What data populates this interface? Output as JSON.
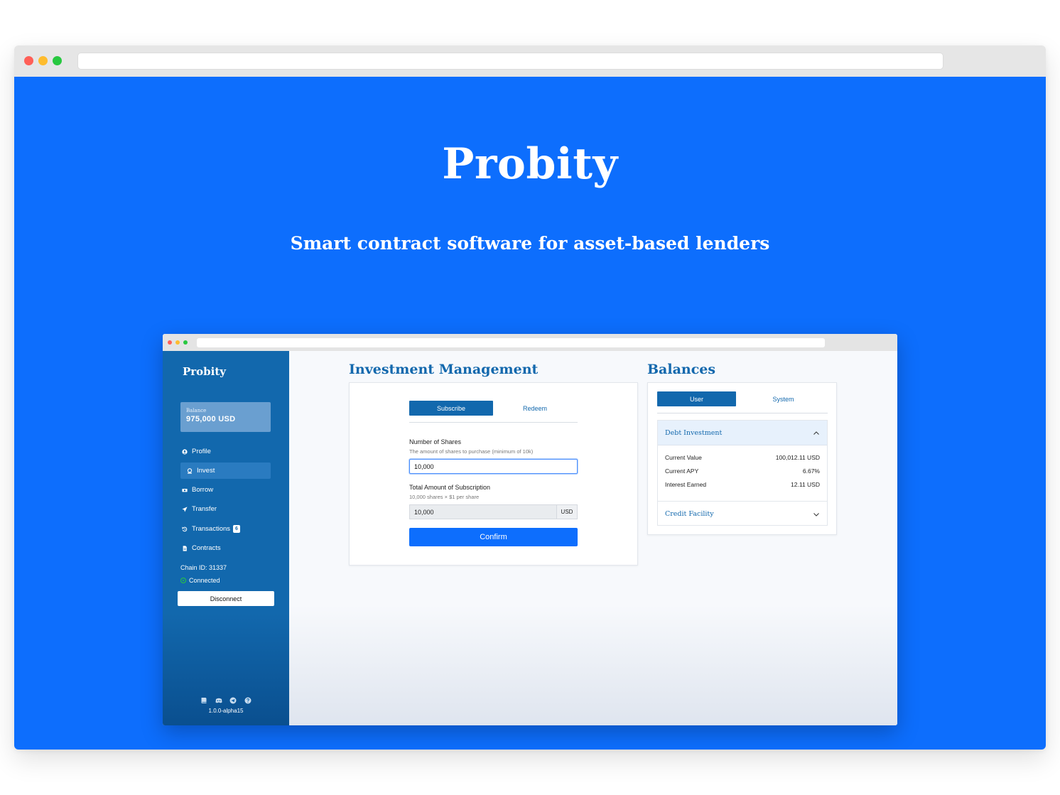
{
  "hero": {
    "title": "Probity",
    "subtitle": "Smart contract software for asset-based lenders"
  },
  "app": {
    "logo": "Probity",
    "balance": {
      "label": "Balance",
      "value": "975,000 USD"
    },
    "nav": [
      {
        "label": "Profile",
        "icon": "profile-icon",
        "active": false
      },
      {
        "label": "Invest",
        "icon": "invest-icon",
        "active": true
      },
      {
        "label": "Borrow",
        "icon": "borrow-icon",
        "active": false
      },
      {
        "label": "Transfer",
        "icon": "transfer-icon",
        "active": false
      },
      {
        "label": "Transactions",
        "icon": "transactions-icon",
        "active": false,
        "badge": "6"
      },
      {
        "label": "Contracts",
        "icon": "contracts-icon",
        "active": false
      }
    ],
    "chain_id": "Chain ID: 31337",
    "status": "Connected",
    "disconnect_label": "Disconnect",
    "footer_icons": [
      "docs-icon",
      "discord-icon",
      "telegram-icon",
      "help-icon"
    ],
    "version": "1.0.0-alpha15"
  },
  "investment": {
    "title": "Investment Management",
    "tabs": {
      "subscribe": "Subscribe",
      "redeem": "Redeem"
    },
    "shares": {
      "label": "Number of Shares",
      "hint": "The amount of shares to purchase (minimum of 10k)",
      "value": "10,000"
    },
    "total": {
      "label": "Total Amount of Subscription",
      "hint": "10,000 shares × $1 per share",
      "value": "10,000",
      "unit": "USD"
    },
    "confirm_label": "Confirm"
  },
  "balances": {
    "title": "Balances",
    "tabs": {
      "user": "User",
      "system": "System"
    },
    "debt": {
      "title": "Debt Investment",
      "rows": [
        {
          "label": "Current Value",
          "value": "100,012.11 USD"
        },
        {
          "label": "Current APY",
          "value": "6.67%"
        },
        {
          "label": "Interest Earned",
          "value": "12.11 USD"
        }
      ]
    },
    "credit_title": "Credit Facility"
  },
  "colors": {
    "hero_bg": "#0d6efd",
    "sidebar_bg": "#1268ad",
    "accent": "#1268ad",
    "confirm_btn": "#0d6efd",
    "connected": "#28c840"
  }
}
